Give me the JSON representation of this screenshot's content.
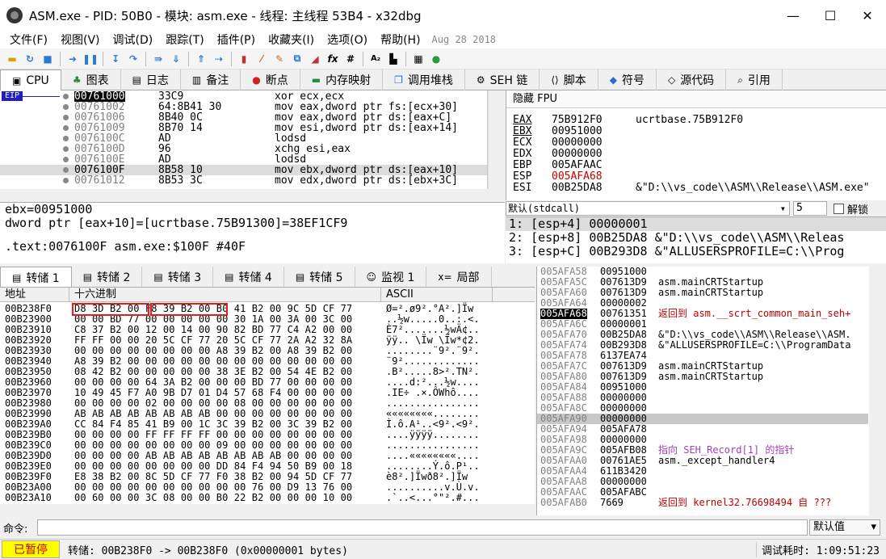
{
  "window": {
    "title": "ASM.exe - PID: 50B0 - 模块: asm.exe - 线程: 主线程 53B4 - x32dbg",
    "min": "—",
    "max": "☐",
    "close": "✕"
  },
  "menu": {
    "items": [
      "文件(F)",
      "视图(V)",
      "调试(D)",
      "跟踪(T)",
      "插件(P)",
      "收藏夹(I)",
      "选项(O)",
      "帮助(H)"
    ],
    "date": "Aug 28 2018"
  },
  "tabs_top": [
    "CPU",
    "图表",
    "日志",
    "备注",
    "断点",
    "内存映射",
    "调用堆栈",
    "SEH 链",
    "脚本",
    "符号",
    "源代码",
    "引用"
  ],
  "disasm": {
    "eip_label": "EIP",
    "rows": [
      {
        "addr": "00761000",
        "bytes": "33C9",
        "ins": "xor ecx,ecx"
      },
      {
        "addr": "00761002",
        "bytes": "64:8B41 30",
        "ins": "mov eax,dword ptr fs:[ecx+30]"
      },
      {
        "addr": "00761006",
        "bytes": "8B40 0C",
        "ins": "mov eax,dword ptr ds:[eax+C]"
      },
      {
        "addr": "00761009",
        "bytes": "8B70 14",
        "ins": "mov esi,dword ptr ds:[eax+14]"
      },
      {
        "addr": "0076100C",
        "bytes": "AD",
        "ins": "lodsd"
      },
      {
        "addr": "0076100D",
        "bytes": "96",
        "ins": "xchg esi,eax"
      },
      {
        "addr": "0076100E",
        "bytes": "AD",
        "ins": "lodsd"
      },
      {
        "addr": "0076100F",
        "bytes": "8B58 10",
        "ins": "mov ebx,dword ptr ds:[eax+10]"
      },
      {
        "addr": "00761012",
        "bytes": "8B53 3C",
        "ins": "mov edx,dword ptr ds:[ebx+3C]"
      }
    ]
  },
  "info": {
    "line1": "ebx=00951000",
    "line2": "dword ptr [eax+10]=[ucrtbase.75B91300]=38EF1CF9",
    "line3": ".text:0076100F asm.exe:$100F #40F"
  },
  "regs": {
    "header": "隐藏 FPU",
    "rows": [
      {
        "name": "EAX",
        "value": "75B912F0",
        "comment": "ucrtbase.75B912F0"
      },
      {
        "name": "EBX",
        "value": "00951000",
        "comment": ""
      },
      {
        "name": "ECX",
        "value": "00000000",
        "comment": ""
      },
      {
        "name": "EDX",
        "value": "00000000",
        "comment": ""
      },
      {
        "name": "EBP",
        "value": "005AFAAC",
        "comment": ""
      },
      {
        "name": "ESP",
        "value": "005AFA68",
        "comment": ""
      },
      {
        "name": "ESI",
        "value": "00B25DA8",
        "comment": "&\"D:\\\\vs_code\\\\ASM\\\\Release\\\\ASM.exe\""
      }
    ]
  },
  "callconv": {
    "selected": "默认(stdcall)",
    "count": "5",
    "unlock": "解锁"
  },
  "args": [
    "1: [esp+4] 00000001",
    "2: [esp+8] 00B25DA8 &\"D:\\\\vs_code\\\\ASM\\\\Releas",
    "3: [esp+C] 00B293D8 &\"ALLUSERSPROFILE=C:\\\\Prog"
  ],
  "tabs_dump": [
    "转储 1",
    "转储 2",
    "转储 3",
    "转储 4",
    "转储 5",
    "监视 1",
    "局部"
  ],
  "dump": {
    "headers": {
      "addr": "地址",
      "hex": "十六进制",
      "ascii": "ASCII"
    },
    "rows": [
      {
        "addr": "00B238F0",
        "hex": "D8 3D B2 00  F8 39 B2 00  B0 41 B2 00  9C 5D CF 77",
        "ascii": "Ø=².ø9².°A².]Ïw"
      },
      {
        "addr": "00B23900",
        "hex": "00 00 BD 77  00 00 00 00  00 30 1A 00  3A 00 3C 00",
        "ascii": "..½w.....0..:.<."
      },
      {
        "addr": "00B23910",
        "hex": "C8 37 B2 00  12 00 14 00  90 82 BD 77  C4 A2 00 00",
        "ascii": "È7².......½wÄ¢.."
      },
      {
        "addr": "00B23920",
        "hex": "FF FF 00 00  20 5C CF 77  20 5C CF 77  2A A2 32 8A",
        "ascii": "ÿÿ.. \\Ïw \\Ïw*¢2."
      },
      {
        "addr": "00B23930",
        "hex": "00 00 00 00  00 00 00 00  A8 39 B2 00  A8 39 B2 00",
        "ascii": "........¨9².¨9²."
      },
      {
        "addr": "00B23940",
        "hex": "A8 39 B2 00  00 00 00 00  00 00 00 00  00 00 00 00",
        "ascii": "¨9²............."
      },
      {
        "addr": "00B23950",
        "hex": "08 42 B2 00  00 00 00 00  38 3E B2 00  54 4E B2 00",
        "ascii": ".B².....8>².TN²."
      },
      {
        "addr": "00B23960",
        "hex": "00 00 00 00  64 3A B2 00  00 00 BD 77  00 00 00 00",
        "ascii": "....d:²...½w...."
      },
      {
        "addr": "00B23970",
        "hex": "10 49 45 F7  A0 9B D7 01  D4 57 68 F4  00 00 00 00",
        "ascii": ".IE÷ .×.ÔWhô...."
      },
      {
        "addr": "00B23980",
        "hex": "00 00 00 00  02 00 00 00  00 08 00 00  00 00 00 00",
        "ascii": "................"
      },
      {
        "addr": "00B23990",
        "hex": "AB AB AB AB  AB AB AB AB  00 00 00 00  00 00 00 00",
        "ascii": "««««««««........"
      },
      {
        "addr": "00B239A0",
        "hex": "CC 84 F4 85  41 B9 00 1C  3C 39 B2 00  3C 39 B2 00",
        "ascii": "Ì.ô.A¹..<9².<9²."
      },
      {
        "addr": "00B239B0",
        "hex": "00 00 00 00  FF FF FF FF  00 00 00 00  00 00 00 00",
        "ascii": "....ÿÿÿÿ........"
      },
      {
        "addr": "00B239C0",
        "hex": "00 00 00 00  00 00 00 00  09 00 00 00  00 00 00 00",
        "ascii": "................"
      },
      {
        "addr": "00B239D0",
        "hex": "00 00 00 00  AB AB AB AB  AB AB AB AB  00 00 00 00",
        "ascii": "....««««««««...."
      },
      {
        "addr": "00B239E0",
        "hex": "00 00 00 00  00 00 00 00  DD 84 F4 94  50 B9 00 18",
        "ascii": "........Ý.ô.P¹.."
      },
      {
        "addr": "00B239F0",
        "hex": "E8 38 B2 00  8C 5D CF 77  F0 38 B2 00  94 5D CF 77",
        "ascii": "è8².]Ïwð8².]Ïw"
      },
      {
        "addr": "00B23A00",
        "hex": "00 00 00 00  00 00 00 00  00 00 76 00  D9 13 76 00",
        "ascii": "..........v.Ù.v."
      },
      {
        "addr": "00B23A10",
        "hex": "00 60 00 00  3C 08 00 00  B0 22 B2 00  00 00 10 00",
        "ascii": ".`..<...°\"².#..."
      }
    ]
  },
  "stack": {
    "rows": [
      {
        "addr": "005AFA58",
        "value": "00951000",
        "comment": ""
      },
      {
        "addr": "005AFA5C",
        "value": "007613D9",
        "comment": "asm.mainCRTStartup"
      },
      {
        "addr": "005AFA60",
        "value": "007613D9",
        "comment": "asm.mainCRTStartup"
      },
      {
        "addr": "005AFA64",
        "value": "00000002",
        "comment": ""
      },
      {
        "addr": "005AFA68",
        "value": "00761351",
        "comment": "返回到 asm.__scrt_common_main_seh+"
      },
      {
        "addr": "005AFA6C",
        "value": "00000001",
        "comment": ""
      },
      {
        "addr": "005AFA70",
        "value": "00B25DA8",
        "comment": "&\"D:\\\\vs_code\\\\ASM\\\\Release\\\\ASM."
      },
      {
        "addr": "005AFA74",
        "value": "00B293D8",
        "comment": "&\"ALLUSERSPROFILE=C:\\\\ProgramData"
      },
      {
        "addr": "005AFA78",
        "value": "6137EA74",
        "comment": ""
      },
      {
        "addr": "005AFA7C",
        "value": "007613D9",
        "comment": "asm.mainCRTStartup"
      },
      {
        "addr": "005AFA80",
        "value": "007613D9",
        "comment": "asm.mainCRTStartup"
      },
      {
        "addr": "005AFA84",
        "value": "00951000",
        "comment": ""
      },
      {
        "addr": "005AFA88",
        "value": "00000000",
        "comment": ""
      },
      {
        "addr": "005AFA8C",
        "value": "00000000",
        "comment": ""
      },
      {
        "addr": "005AFA90",
        "value": "00000000",
        "comment": ""
      },
      {
        "addr": "005AFA94",
        "value": "005AFA78",
        "comment": ""
      },
      {
        "addr": "005AFA98",
        "value": "00000000",
        "comment": ""
      },
      {
        "addr": "005AFA9C",
        "value": "005AFB08",
        "comment": "指向 SEH_Record[1] 的指针"
      },
      {
        "addr": "005AFAA0",
        "value": "00761AE5",
        "comment": "asm._except_handler4"
      },
      {
        "addr": "005AFAA4",
        "value": "611B3420",
        "comment": ""
      },
      {
        "addr": "005AFAA8",
        "value": "00000000",
        "comment": ""
      },
      {
        "addr": "005AFAAC",
        "value": "005AFABC",
        "comment": ""
      },
      {
        "addr": "005AFAB0",
        "value": "7669",
        "comment": "返回到 kernel32.76698494 自 ???"
      }
    ]
  },
  "cmd": {
    "label": "命令:",
    "default": "默认值"
  },
  "status": {
    "paused": "已暂停",
    "message": "转储: 00B238F0 -> 00B238F0 (0x00000001 bytes)",
    "time": "调试耗时: 1:09:51:23"
  }
}
